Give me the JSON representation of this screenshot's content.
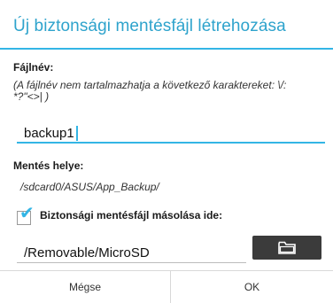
{
  "dialog": {
    "title": "Új biztonsági mentésfájl létrehozása",
    "filename_label": "Fájlnév:",
    "filename_hint": "(A fájlnév nem tartalmazhatja a következő karaktereket: \\/:\n*?\"<>| )",
    "filename_value": "backup1",
    "save_location_label": "Mentés helye:",
    "save_location_path": "/sdcard0/ASUS/App_Backup/",
    "copy_checkbox_label": "Biztonsági mentésfájl másolása ide:",
    "copy_checkbox_checked": true,
    "copy_destination_value": "/Removable/MicroSD",
    "browse_icon": "folder-icon",
    "cancel_label": "Mégse",
    "ok_label": "OK"
  },
  "colors": {
    "accent": "#33b5e5",
    "title": "#2ea3cc",
    "button_dark": "#3b3b3b"
  }
}
